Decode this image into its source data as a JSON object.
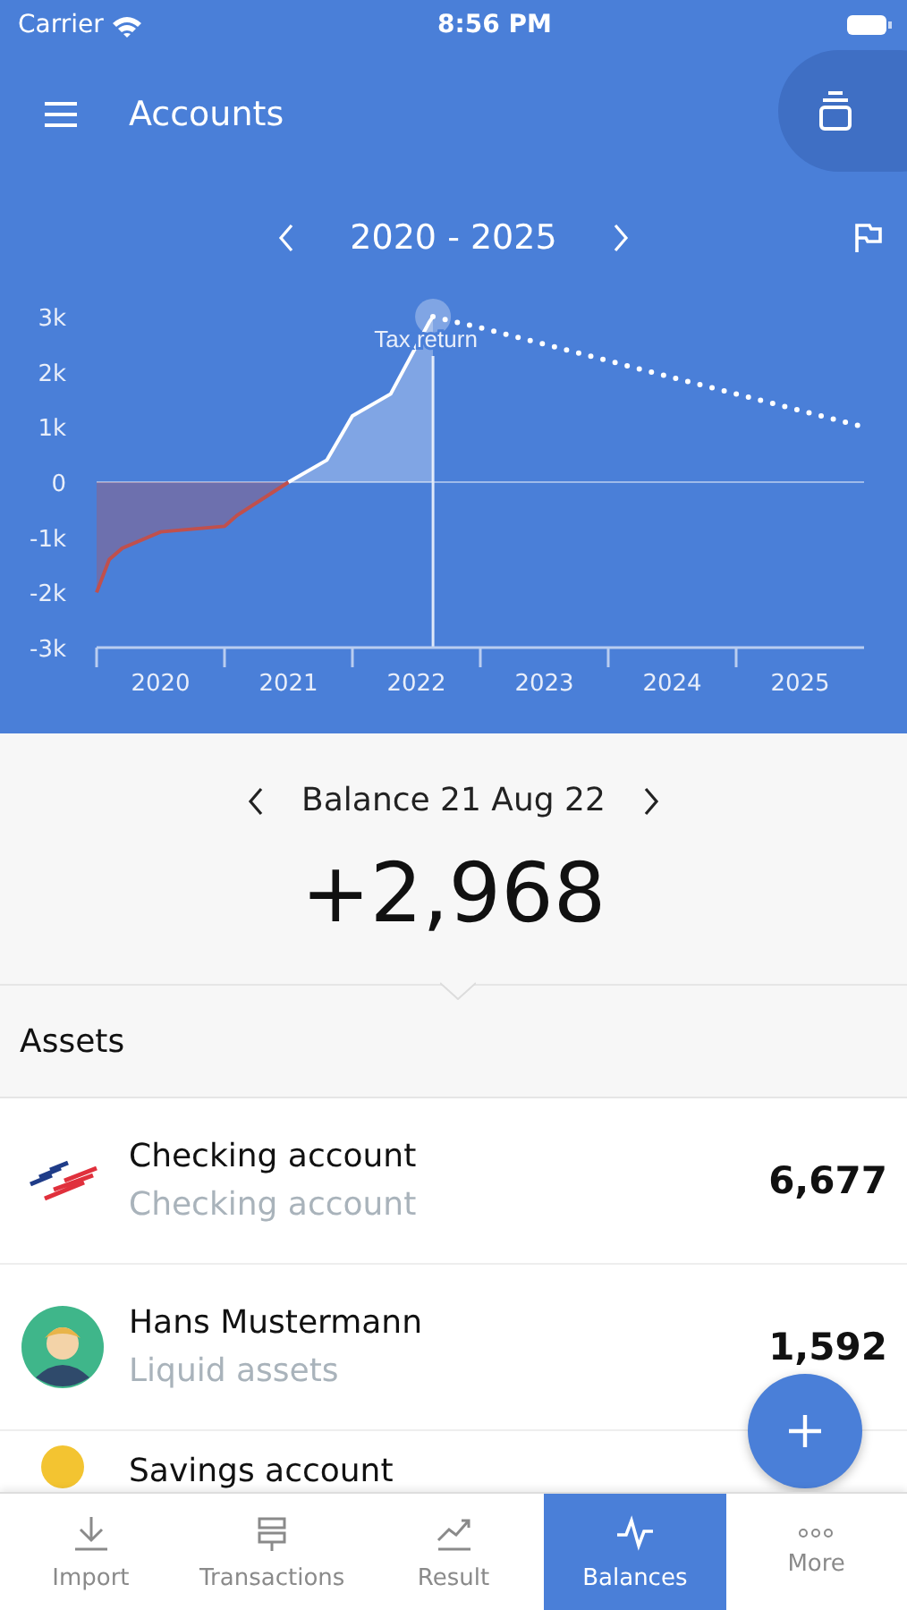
{
  "status_bar": {
    "carrier": "Carrier",
    "time": "8:56 PM"
  },
  "header": {
    "title": "Accounts"
  },
  "period": {
    "label": "2020 - 2025"
  },
  "chart_data": {
    "type": "area",
    "x": [
      2020.0,
      2020.1,
      2020.2,
      2020.5,
      2021.0,
      2021.1,
      2021.5,
      2021.8,
      2021.95,
      2022.0,
      2022.3,
      2022.6,
      2022.63,
      2023,
      2024,
      2025,
      2026
    ],
    "series": [
      {
        "color": "#c0504d",
        "type": "area",
        "values": [
          -2000,
          -1400,
          -1200,
          -900,
          -800,
          -600,
          0,
          null,
          null,
          null,
          null,
          null,
          null,
          null,
          null,
          null,
          null
        ]
      },
      {
        "color": "#ffffff",
        "type": "area",
        "values": [
          null,
          null,
          null,
          null,
          null,
          null,
          0,
          400,
          1000,
          1200,
          1600,
          2900,
          3000,
          null,
          null,
          null,
          null
        ]
      },
      {
        "color": "#ffffff",
        "type": "line",
        "line_style": "dotted",
        "values": [
          null,
          null,
          null,
          null,
          null,
          null,
          null,
          null,
          null,
          null,
          null,
          null,
          3000,
          2800,
          2200,
          1600,
          1000
        ]
      }
    ],
    "xlim": [
      2020,
      2026
    ],
    "ylim": [
      -3000,
      3000
    ],
    "xticks": [
      {
        "value": 2020.5,
        "label": "2020"
      },
      {
        "value": 2021.5,
        "label": "2021"
      },
      {
        "value": 2022.5,
        "label": "2022"
      },
      {
        "value": 2023.5,
        "label": "2023"
      },
      {
        "value": 2024.5,
        "label": "2024"
      },
      {
        "value": 2025.5,
        "label": "2025"
      }
    ],
    "yticks": [
      {
        "value": 3000,
        "label": "3k"
      },
      {
        "value": 2000,
        "label": "2k"
      },
      {
        "value": 1000,
        "label": "1k"
      },
      {
        "value": 0,
        "label": "0"
      },
      {
        "value": -1000,
        "label": "-1k"
      },
      {
        "value": -2000,
        "label": "-2k"
      },
      {
        "value": -3000,
        "label": "-3k"
      }
    ],
    "ref_lines": [
      {
        "axis": "y",
        "value": 0
      },
      {
        "axis": "x",
        "value": 2022.63
      }
    ],
    "annotations": [
      {
        "x": 2022.63,
        "y": 3000,
        "text": "Tax return"
      }
    ]
  },
  "balance": {
    "label": "Balance 21 Aug 22",
    "amount": "+2,968"
  },
  "section": {
    "title": "Assets"
  },
  "accounts": [
    {
      "kind": "bank",
      "name": "Checking account",
      "type": "Checking account",
      "amount": "6,677"
    },
    {
      "kind": "person",
      "name": "Hans Mustermann",
      "type": "Liquid assets",
      "amount": "1,592"
    },
    {
      "kind": "coin",
      "name": "Savings account"
    }
  ],
  "tabs": [
    {
      "kind": "import",
      "label": "Import",
      "selected": false
    },
    {
      "kind": "transactions",
      "label": "Transactions",
      "selected": false
    },
    {
      "kind": "result",
      "label": "Result",
      "selected": false
    },
    {
      "kind": "balances",
      "label": "Balances",
      "selected": true
    },
    {
      "kind": "more",
      "label": "More",
      "selected": false
    }
  ]
}
